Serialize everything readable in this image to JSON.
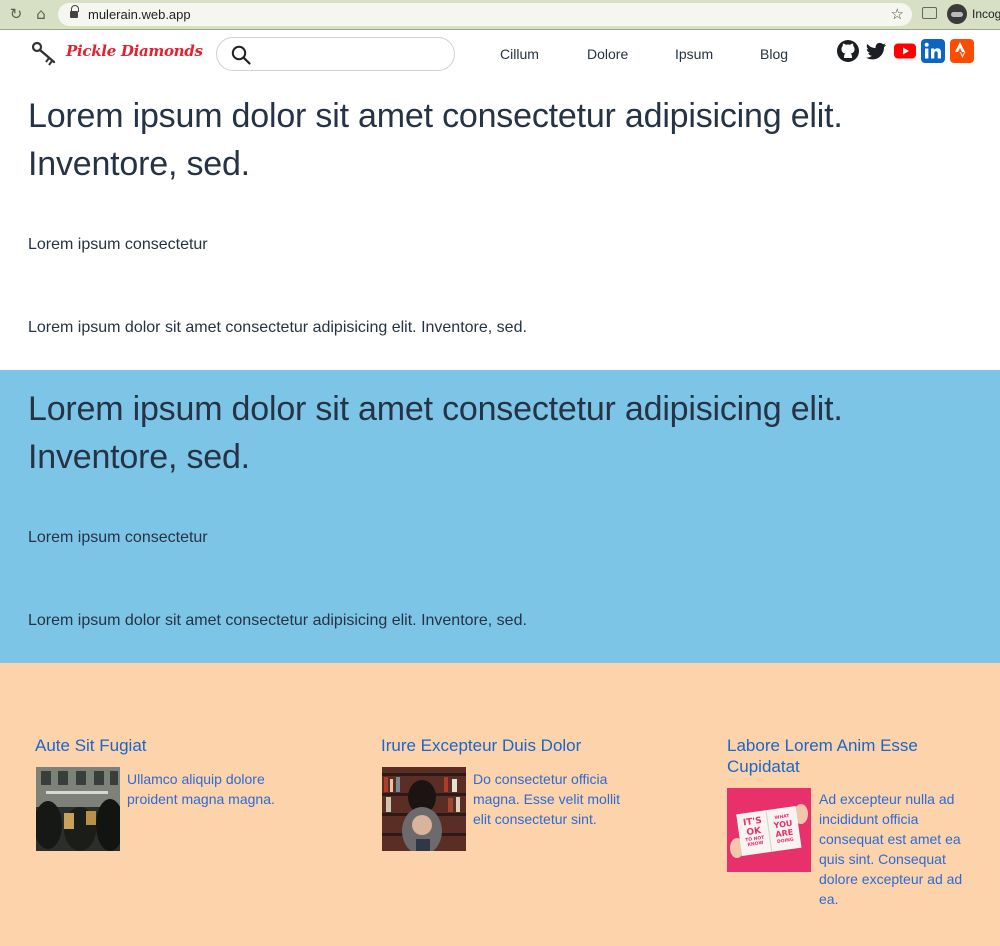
{
  "browser": {
    "url": "mulerain.web.app",
    "profile_label": "Incog"
  },
  "header": {
    "logo_text": "Pickle Diamonds",
    "search_placeholder": "",
    "nav": [
      {
        "label": "Cillum"
      },
      {
        "label": "Dolore"
      },
      {
        "label": "Ipsum"
      },
      {
        "label": "Blog"
      }
    ],
    "social": [
      "github-icon",
      "twitter-icon",
      "youtube-icon",
      "linkedin-icon",
      "strava-icon"
    ]
  },
  "hero_white": {
    "title": "Lorem ipsum dolor sit amet consectetur adipisicing elit. Inventore, sed.",
    "subtitle": "Lorem ipsum consectetur",
    "paragraph": "Lorem ipsum dolor sit amet consectetur adipisicing elit. Inventore, sed."
  },
  "hero_blue": {
    "title": "Lorem ipsum dolor sit amet consectetur adipisicing elit. Inventore, sed.",
    "subtitle": "Lorem ipsum consectetur",
    "paragraph": "Lorem ipsum dolor sit amet consectetur adipisicing elit. Inventore, sed."
  },
  "cards": [
    {
      "title": "Aute Sit Fugiat",
      "text": "Ullamco aliquip dolore proident magna magna."
    },
    {
      "title": "Irure Excepteur Duis Dolor",
      "text": "Do consectetur officia magna. Esse velit mollit elit consectetur sint."
    },
    {
      "title": "Labore Lorem Anim Esse Cupidatat",
      "text": "Ad excepteur nulla ad incididunt officia consequat est amet ea quis sint. Consequat dolore excepteur ad ad ea.",
      "image_text": [
        "IT'S",
        "OK",
        "TO NOT",
        "KNOW",
        "WHAT",
        "YOU",
        "ARE",
        "DOING"
      ]
    }
  ],
  "colors": {
    "section_blue": "#7dc5e6",
    "section_peach": "#fcd3ab",
    "link_blue": "#1a66c9",
    "logo_red": "#e5202e"
  }
}
